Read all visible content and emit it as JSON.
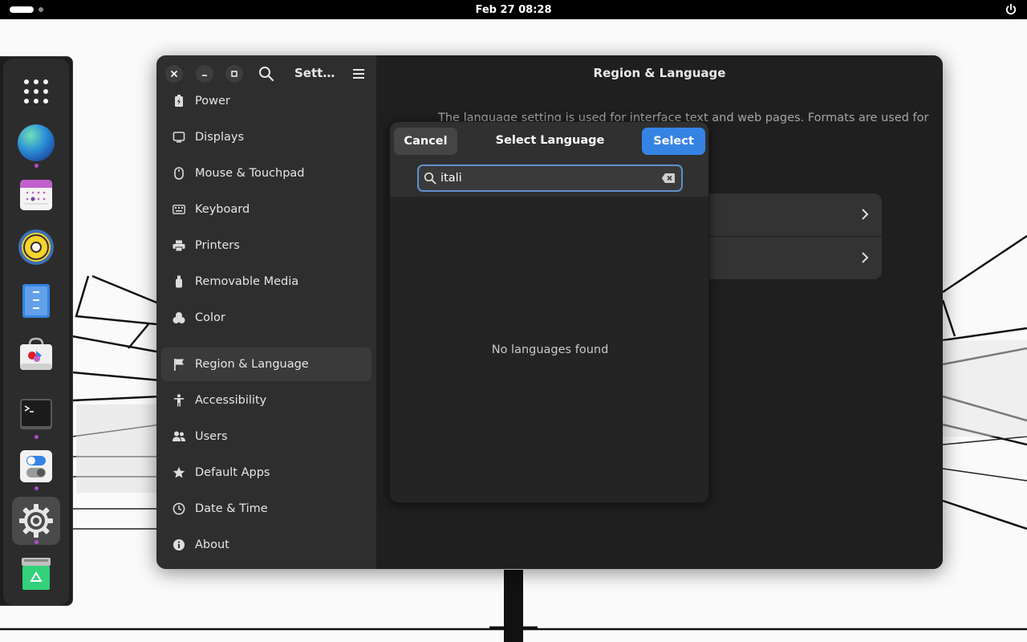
{
  "topbar": {
    "clock": "Feb 27  08:28",
    "icons": [
      "activities-indicator",
      "power-icon"
    ]
  },
  "dock": {
    "apps": [
      {
        "name": "app-grid",
        "icon": "app-grid-icon"
      },
      {
        "name": "browser",
        "icon": "browser-icon",
        "running": true
      },
      {
        "name": "calendar",
        "icon": "calendar-icon"
      },
      {
        "name": "rhythmbox",
        "icon": "speaker-icon"
      },
      {
        "name": "files",
        "icon": "files-icon"
      },
      {
        "name": "software",
        "icon": "software-store-icon"
      },
      {
        "name": "terminal",
        "icon": "terminal-icon",
        "running": true
      },
      {
        "name": "tweaks",
        "icon": "toggle-icon",
        "running": true
      },
      {
        "name": "settings",
        "icon": "gear-icon",
        "running": true,
        "active": true
      },
      {
        "name": "trash",
        "icon": "trash-icon"
      }
    ]
  },
  "settings": {
    "sidebar_title": "Sett…",
    "nav": [
      {
        "label": "Power",
        "icon": "power-battery-icon"
      },
      {
        "label": "Displays",
        "icon": "display-icon"
      },
      {
        "label": "Mouse & Touchpad",
        "icon": "mouse-icon"
      },
      {
        "label": "Keyboard",
        "icon": "keyboard-icon"
      },
      {
        "label": "Printers",
        "icon": "printer-icon"
      },
      {
        "label": "Removable Media",
        "icon": "usb-icon"
      },
      {
        "label": "Color",
        "icon": "color-icon"
      },
      {
        "label": "Region & Language",
        "icon": "flag-icon",
        "selected": true
      },
      {
        "label": "Accessibility",
        "icon": "accessibility-icon"
      },
      {
        "label": "Users",
        "icon": "users-icon"
      },
      {
        "label": "Default Apps",
        "icon": "star-icon"
      },
      {
        "label": "Date & Time",
        "icon": "clock-icon"
      },
      {
        "label": "About",
        "icon": "info-icon"
      }
    ],
    "content_title": "Region & Language",
    "content_description": "The language setting is used for interface text and web pages. Formats are used for"
  },
  "dialog": {
    "title": "Select Language",
    "cancel_label": "Cancel",
    "select_label": "Select",
    "search_value": "itali",
    "empty_text": "No languages found"
  },
  "colors": {
    "accent": "#3584e4",
    "window_bg": "#222222",
    "sidebar_bg": "#2e2e2e",
    "topbar_bg": "#000000"
  }
}
